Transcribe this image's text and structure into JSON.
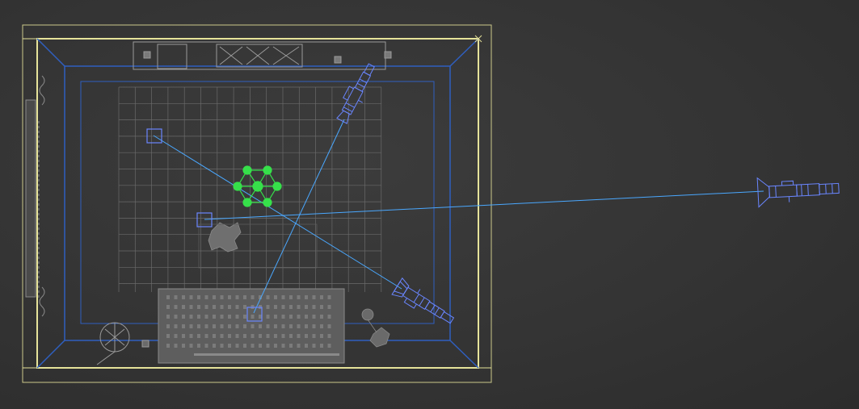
{
  "viewport": {
    "view": "top",
    "shading": "wireframe",
    "colors": {
      "background": "#363636",
      "room_outline": "#e6e39a",
      "room_inner": "#2f5fc0",
      "floor_grid": "#6a6a6a",
      "furniture": "#8a8a8a",
      "camera": "#6a86ff",
      "camera_line": "#4aa8ff",
      "selected_object": "#36e04a"
    }
  },
  "objects": {
    "room": {
      "name": "room-box",
      "icon": "box-icon"
    },
    "cameras": [
      {
        "name": "camera-top-right",
        "icon": "camera-icon"
      },
      {
        "name": "camera-bottom-right",
        "icon": "camera-icon"
      },
      {
        "name": "camera-far-right",
        "icon": "camera-icon"
      }
    ],
    "targets": [
      {
        "name": "camera-target-a",
        "icon": "target-icon"
      },
      {
        "name": "camera-target-b",
        "icon": "target-icon"
      },
      {
        "name": "camera-target-c",
        "icon": "target-icon"
      }
    ],
    "selected": {
      "name": "light-array",
      "icon": "light-cluster-icon"
    },
    "furniture": [
      {
        "name": "bookshelf-top",
        "icon": "shelf-icon"
      },
      {
        "name": "side-curtain",
        "icon": "curtain-icon"
      },
      {
        "name": "rug-bottom",
        "icon": "rug-icon"
      },
      {
        "name": "plant-corner",
        "icon": "plant-icon"
      },
      {
        "name": "plant-floor",
        "icon": "plant-icon"
      },
      {
        "name": "lamp-corner",
        "icon": "lamp-icon"
      }
    ]
  }
}
